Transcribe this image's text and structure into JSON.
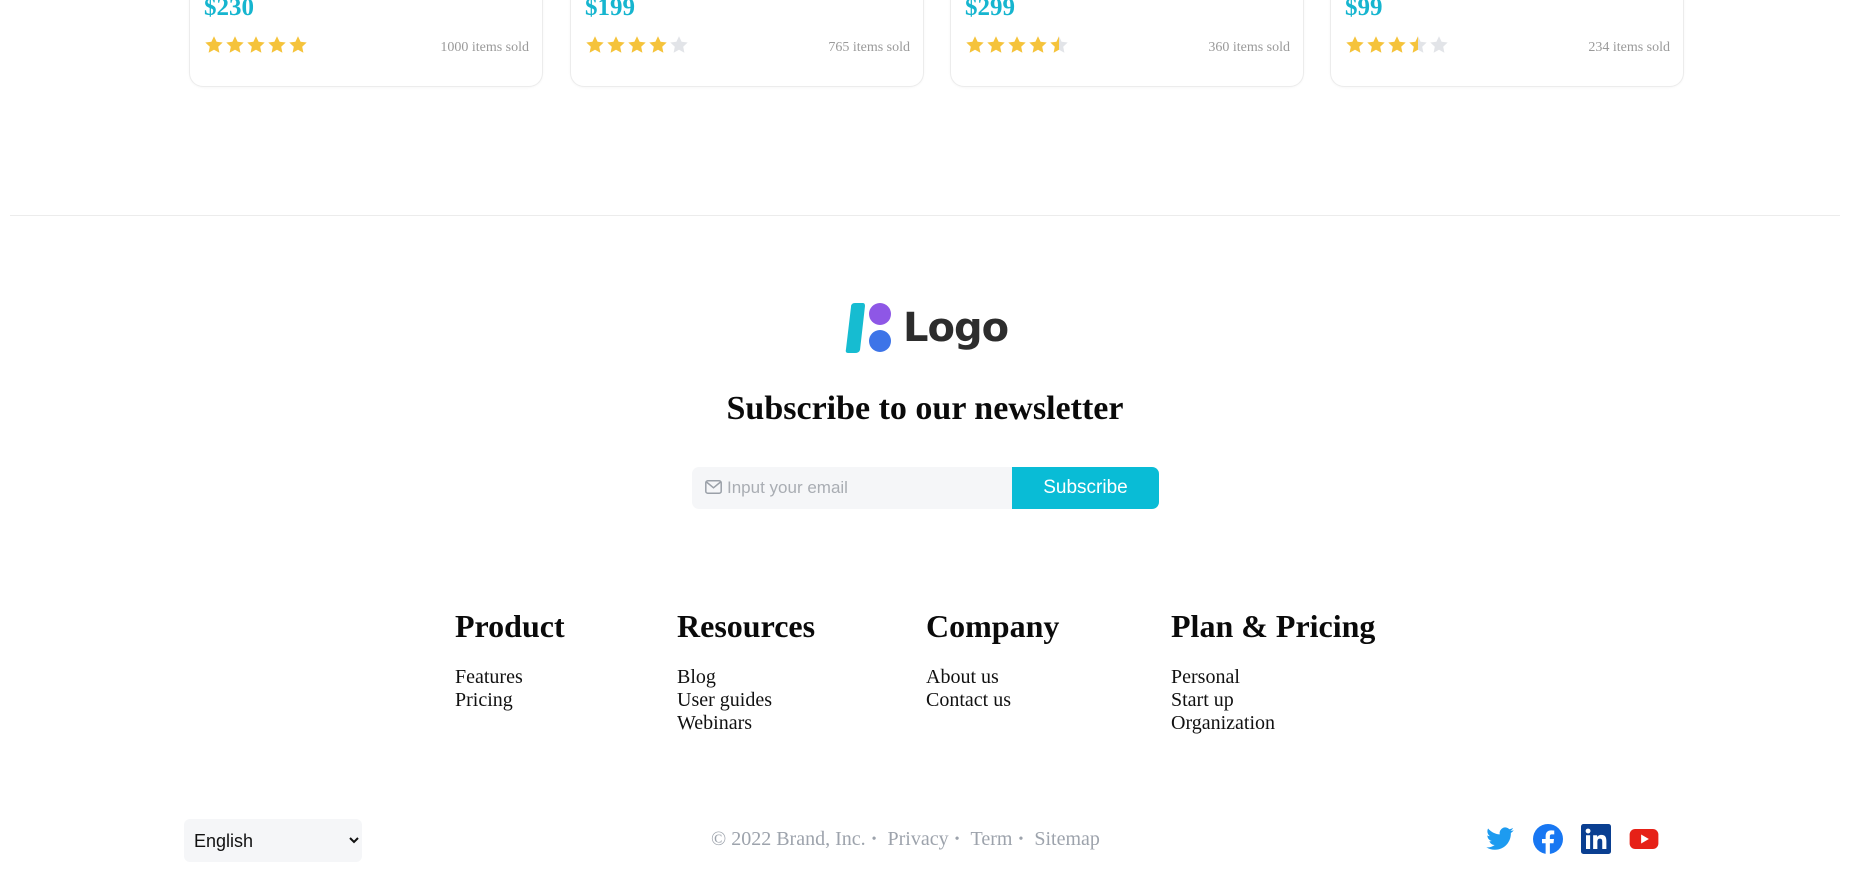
{
  "products": [
    {
      "price": "$230",
      "rating": 5,
      "sold": "1000 items sold"
    },
    {
      "price": "$199",
      "rating": 4,
      "sold": "765 items sold"
    },
    {
      "price": "$299",
      "rating": 4.5,
      "sold": "360 items sold"
    },
    {
      "price": "$99",
      "rating": 3.5,
      "sold": "234 items sold"
    }
  ],
  "logo": {
    "text": "Logo"
  },
  "newsletter": {
    "title": "Subscribe to our newsletter",
    "placeholder": "Input your email",
    "button_label": "Subscribe"
  },
  "footer": {
    "columns": [
      {
        "heading": "Product",
        "links": [
          "Features",
          "Pricing"
        ]
      },
      {
        "heading": "Resources",
        "links": [
          "Blog",
          "User guides",
          "Webinars"
        ]
      },
      {
        "heading": "Company",
        "links": [
          "About us",
          "Contact us"
        ]
      },
      {
        "heading": "Plan & Pricing",
        "links": [
          "Personal",
          "Start up",
          "Organization"
        ]
      }
    ]
  },
  "bottom": {
    "language": "English",
    "copyright": "© 2022 Brand, Inc.",
    "links": [
      "Privacy",
      "Term",
      "Sitemap"
    ],
    "separator": "•"
  },
  "socials": [
    "twitter-icon",
    "facebook-icon",
    "linkedin-icon",
    "youtube-icon"
  ],
  "colors": {
    "accent": "#09bcd6",
    "price": "#16b5cf",
    "star_filled": "#f5c33b",
    "star_empty": "#e2e4e8",
    "muted": "#9da3ac"
  }
}
